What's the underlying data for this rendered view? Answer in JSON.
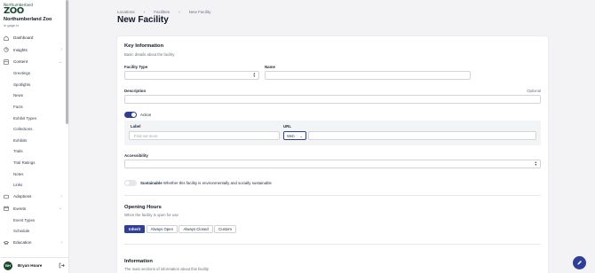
{
  "brand": {
    "logo_top": "Northumberland",
    "logo_main": "ZOO",
    "name": "Northumberland Zoo",
    "sub": "in gage.io"
  },
  "sidebar": {
    "items": [
      {
        "label": "Dashboard",
        "icon": "home-icon",
        "chevron": ""
      },
      {
        "label": "Insights",
        "icon": "chart-icon",
        "chevron": "›"
      },
      {
        "label": "Content",
        "icon": "grid-icon",
        "chevron": "⌄"
      }
    ],
    "content_subitems": [
      "Greetings",
      "Spotlights",
      "News",
      "Facts",
      "Exhibit Types",
      "Collections",
      "Exhibits",
      "Trails",
      "Trail Ratings",
      "Notes",
      "Links"
    ],
    "items2": [
      {
        "label": "Adoptions",
        "icon": "heart-icon",
        "chevron": "›"
      },
      {
        "label": "Events",
        "icon": "calendar-icon",
        "chevron": "⌄"
      }
    ],
    "events_subitems": [
      "Event Types",
      "Schedule"
    ],
    "items3": [
      {
        "label": "Education",
        "icon": "graduation-icon",
        "chevron": "›"
      }
    ]
  },
  "user": {
    "initials": "BH",
    "name": "Bryan Hoare"
  },
  "breadcrumb": [
    "Locations",
    "›",
    "Facilities",
    "›",
    "New Facility"
  ],
  "page": {
    "title": "New Facility"
  },
  "key_info": {
    "title": "Key Information",
    "subtitle": "Basic details about the facility",
    "facility_type_label": "Facility Type",
    "name_label": "Name",
    "description_label": "Description",
    "optional": "Optional",
    "action_label": "Action",
    "label_label": "Label",
    "label_placeholder": "Find out more",
    "url_label": "URL",
    "url_type": "Web",
    "accessibility_label": "Accessibility",
    "sustainable_label": "Sustainable",
    "sustainable_desc": "Whether this facility is environmentally and socially sustainable"
  },
  "opening_hours": {
    "title": "Opening Hours",
    "subtitle": "When the facility is open for use",
    "options": [
      "Inherit",
      "Always Open",
      "Always Closed",
      "Custom"
    ]
  },
  "information": {
    "title": "Information",
    "subtitle": "The main sections of information about this facility"
  },
  "colors": {
    "accent": "#2f3f98",
    "brand_green": "#1a4a2e"
  }
}
